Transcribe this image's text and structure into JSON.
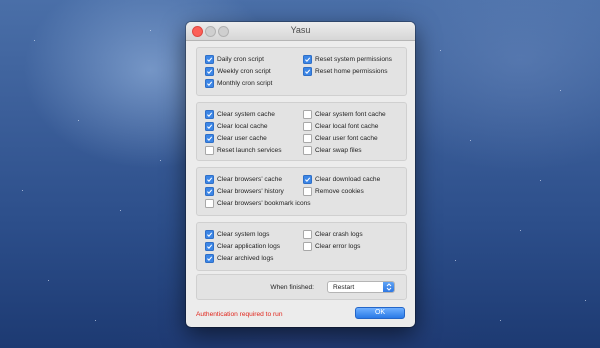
{
  "window": {
    "title": "Yasu"
  },
  "groups": {
    "maintenance": {
      "daily_cron": {
        "label": "Daily cron script",
        "checked": true
      },
      "weekly_cron": {
        "label": "Weekly cron script",
        "checked": true
      },
      "monthly_cron": {
        "label": "Monthly cron script",
        "checked": true
      },
      "reset_system_permissions": {
        "label": "Reset system permissions",
        "checked": true
      },
      "reset_home_permissions": {
        "label": "Reset home permissions",
        "checked": true
      }
    },
    "caches": {
      "clear_system_cache": {
        "label": "Clear system cache",
        "checked": true
      },
      "clear_local_cache": {
        "label": "Clear local cache",
        "checked": true
      },
      "clear_user_cache": {
        "label": "Clear user cache",
        "checked": true
      },
      "reset_launch_services": {
        "label": "Reset launch services",
        "checked": false
      },
      "clear_system_font_cache": {
        "label": "Clear system font cache",
        "checked": false
      },
      "clear_local_font_cache": {
        "label": "Clear local font cache",
        "checked": false
      },
      "clear_user_font_cache": {
        "label": "Clear user font cache",
        "checked": false
      },
      "clear_swap_files": {
        "label": "Clear swap files",
        "checked": false
      }
    },
    "browsers": {
      "clear_browsers_cache": {
        "label": "Clear browsers' cache",
        "checked": true
      },
      "clear_browsers_history": {
        "label": "Clear browsers' history",
        "checked": true
      },
      "clear_browsers_bookmark_icons": {
        "label": "Clear browsers' bookmark icons",
        "checked": false
      },
      "clear_download_cache": {
        "label": "Clear download cache",
        "checked": true
      },
      "remove_cookies": {
        "label": "Remove cookies",
        "checked": false
      }
    },
    "logs": {
      "clear_system_logs": {
        "label": "Clear system logs",
        "checked": true
      },
      "clear_application_logs": {
        "label": "Clear application logs",
        "checked": true
      },
      "clear_archived_logs": {
        "label": "Clear archived logs",
        "checked": true
      },
      "clear_crash_logs": {
        "label": "Clear crash logs",
        "checked": false
      },
      "clear_error_logs": {
        "label": "Clear error logs",
        "checked": false
      }
    }
  },
  "finish": {
    "label": "When finished:",
    "value": "Restart"
  },
  "status": {
    "auth_text": "Authentication required to run"
  },
  "buttons": {
    "ok_label": "OK"
  },
  "colors": {
    "accent": "#3c86e6",
    "auth_text": "#e0251b",
    "close_button": "#fc5f57"
  }
}
